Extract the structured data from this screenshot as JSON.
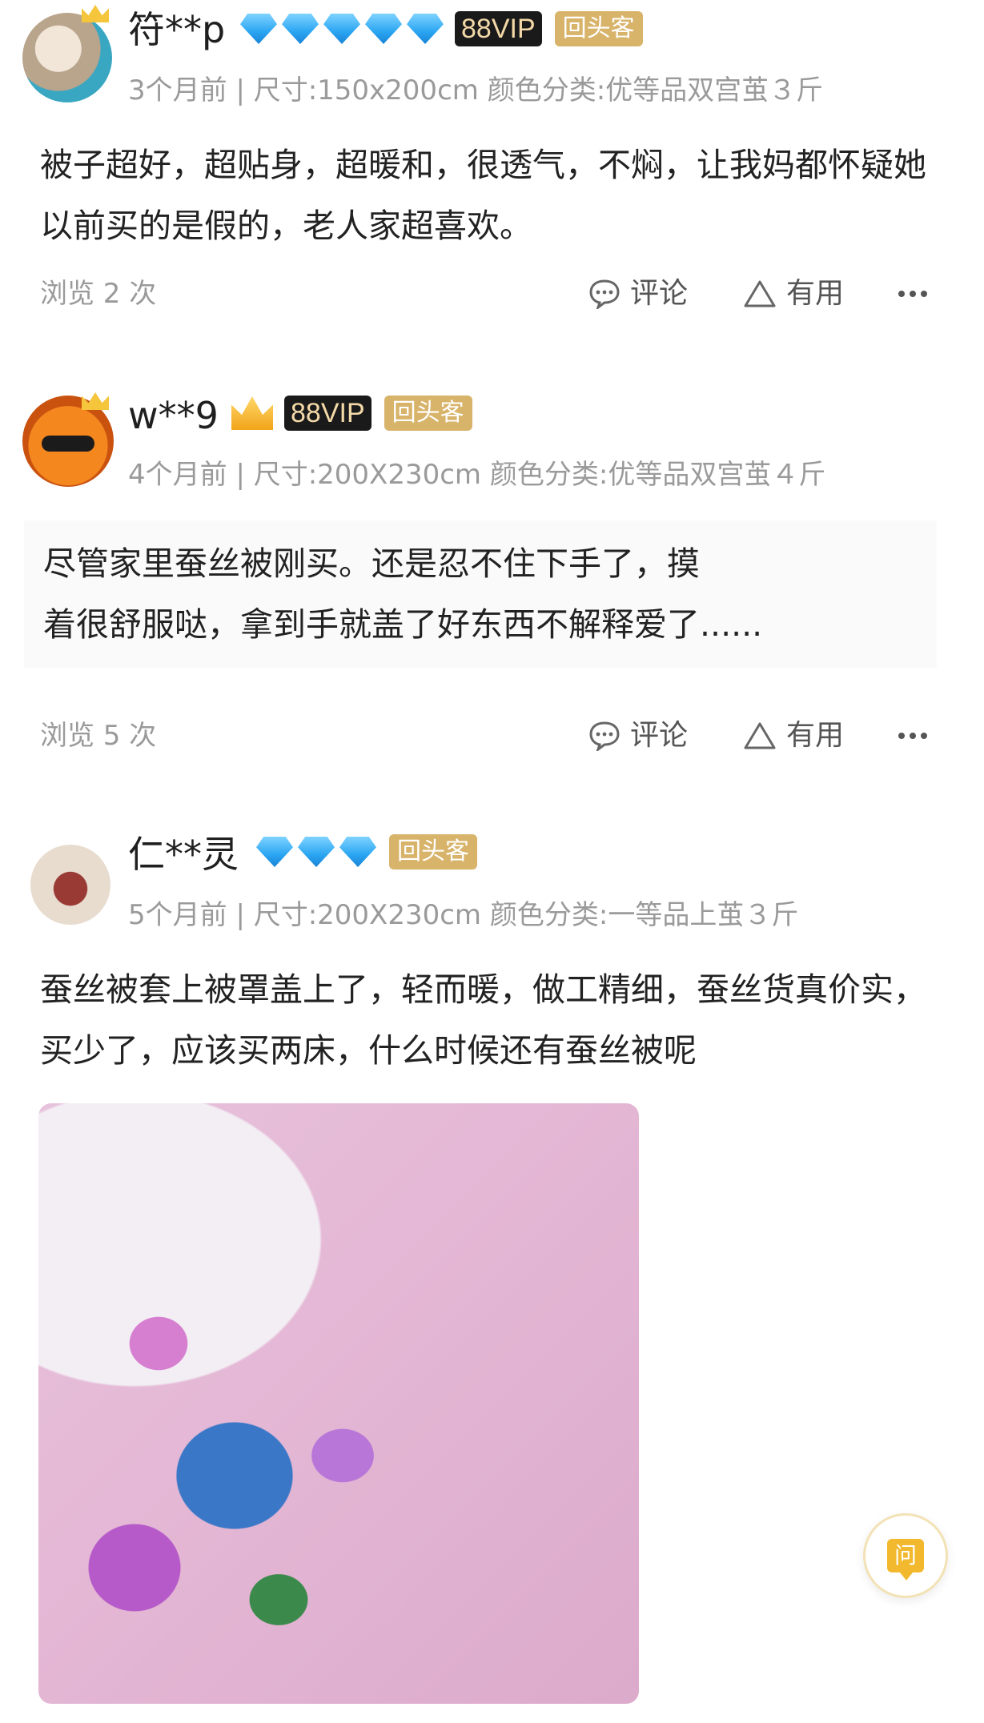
{
  "reviews": [
    {
      "username": "符**p",
      "diamonds": 5,
      "vip": "88VIP",
      "repeat_tag": "回头客",
      "meta": "3个月前 | 尺寸:150x200cm 颜色分类:优等品双宫茧３斤",
      "content": "被子超好，超贴身，超暖和，很透气，不焖，让我妈都怀疑她以前买的是假的，老人家超喜欢。",
      "views": "浏览 2 次"
    },
    {
      "username": "w**9",
      "diamonds": 0,
      "vip": "88VIP",
      "repeat_tag": "回头客",
      "meta": "4个月前 | 尺寸:200X230cm 颜色分类:优等品双宫茧４斤",
      "content_lines": [
        "尽管家里蚕丝被刚买。还是忍不住下手了，摸",
        "着很舒服哒，拿到手就盖了好东西不解释爱了......"
      ],
      "views": "浏览 5 次"
    },
    {
      "username": "仁**灵",
      "diamonds": 3,
      "repeat_tag": "回头客",
      "meta": "5个月前 | 尺寸:200X230cm 颜色分类:一等品上茧３斤",
      "content": "蚕丝被套上被罩盖上了，轻而暖，做工精细，蚕丝货真价实，买少了，应该买两床，什么时候还有蚕丝被呢"
    }
  ],
  "actions": {
    "comment": "评论",
    "useful": "有用"
  },
  "ask_button": {
    "label": "问"
  },
  "colors": {
    "diamond": "#2aa5f2",
    "vip_bg": "#1a1a1a",
    "repeat_bg": "#d8b36a",
    "muted_text": "#9a9a9a",
    "ask_accent": "#f2b92e"
  },
  "icons": {
    "comment": "comment-bubble-icon",
    "useful": "triangle-up-icon",
    "more": "more-dots-icon"
  }
}
